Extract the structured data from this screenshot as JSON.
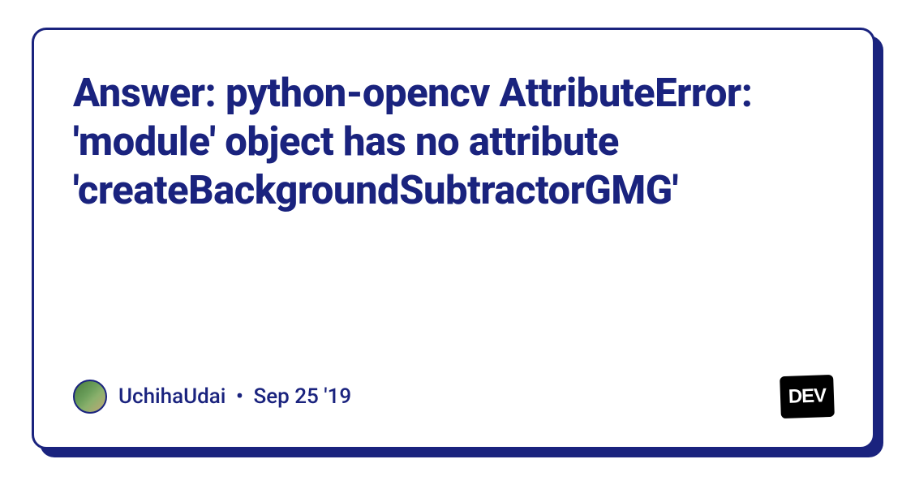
{
  "card": {
    "title": "Answer: python-opencv AttributeError: 'module' object has no attribute 'createBackgroundSubtractorGMG'",
    "author": "UchihaUdai",
    "date": "Sep 25 '19",
    "separator": "•"
  },
  "logo": {
    "text": "DEV"
  }
}
